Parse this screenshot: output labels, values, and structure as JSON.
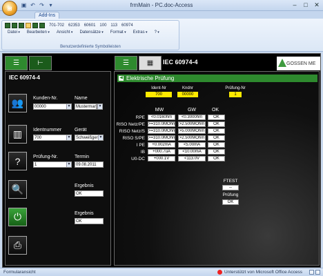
{
  "window": {
    "title": "frmMain - PC.doc-Access",
    "office_button_glyph": "⊞",
    "quick_access": [
      "save-icon",
      "undo-icon",
      "redo-icon",
      "customize-icon"
    ],
    "controls": [
      "minimize-icon",
      "maximize-icon",
      "close-icon"
    ]
  },
  "ribbon": {
    "active_tab": "Add-Ins",
    "toolbar_fields": [
      "701-702",
      "62353",
      "60601",
      "100",
      "113",
      "60974"
    ],
    "menus": [
      "Datei",
      "Bearbeiten",
      "Ansicht",
      "Datensätze",
      "Format",
      "Extras",
      "?"
    ],
    "group_label": "Benutzerdefinierte Symbolleisten"
  },
  "app": {
    "colors": {
      "accent_green": "#2e8a2e",
      "highlight_yellow": "#ffea00"
    },
    "left_title": "IEC 60974-4",
    "right_title": "IEC 60974-4",
    "brand": "GOSSEN ME",
    "form": {
      "kunden_nr_label": "Kunden-Nr.",
      "kunden_nr_value": "00000",
      "name_label": "Name",
      "name_value": "Mustermann",
      "identnummer_label": "Identnummer",
      "identnummer_value": "700",
      "geraet_label": "Gerät",
      "geraet_value": "Schweißger",
      "pruefung_nr_label": "Prüfung-Nr.",
      "pruefung_nr_value": "1",
      "termin_label": "Termin",
      "termin_value": "09.08.2011",
      "ergebnis1_label": "Ergebnis",
      "ergebnis1_value": "OK",
      "ergebnis2_label": "Ergebnis",
      "ergebnis2_value": "OK"
    },
    "test": {
      "section_title": "Elektrische Prüfung",
      "ident_nr_label": "Ident-Nr",
      "ident_nr_value": "700",
      "kndnr_label": "Kndnr",
      "kndnr_value": "00000",
      "pruefung_nr_label": "Prüfung-Nr",
      "pruefung_nr_value": "1",
      "col_mw": "MW",
      "col_gw": "GW",
      "col_ok": "OK",
      "rows": [
        {
          "name": "RPE",
          "mw": "<0.0160hm",
          "gw": "<0.3000hm",
          "ok": "OK"
        },
        {
          "name": "RISO Netz/PE",
          "mw": ">=310.0MOhm",
          "gw": ">2.500MOhm",
          "ok": "OK"
        },
        {
          "name": "RISO Netz/S",
          "mw": ">=310.0MOhm",
          "gw": ">5.000MOhm",
          "ok": "OK"
        },
        {
          "name": "RISO S/PE",
          "mw": ">=310.0MOhm",
          "gw": ">2.500MOhm",
          "ok": "OK"
        },
        {
          "name": "I PE",
          "mw": "+0.002mA",
          "gw": "<5.00mA",
          "ok": "OK"
        },
        {
          "name": "IB",
          "mw": "+000.7uA",
          "gw": "<10.00mA",
          "ok": "OK"
        },
        {
          "name": "U0-DC",
          "mw": "+000.1V",
          "gw": "<113.0V",
          "ok": "OK"
        }
      ],
      "ftest_label": "FTEST",
      "ftest_value": "--",
      "pruefung_label": "Prüfung",
      "pruefung_value": "OK"
    }
  },
  "status": {
    "left": "Formularansicht",
    "right": "Unterstützt von Microsoft Office Access"
  }
}
